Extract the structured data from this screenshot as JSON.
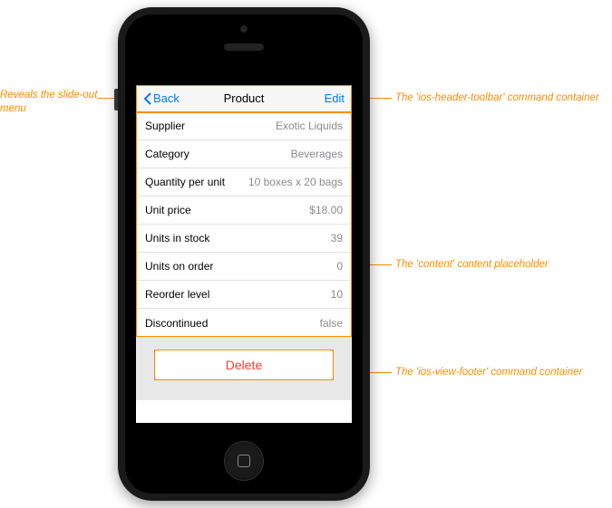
{
  "toolbar": {
    "back_label": "Back",
    "title": "Product",
    "edit_label": "Edit"
  },
  "details": [
    {
      "label": "Supplier",
      "value": "Exotic Liquids"
    },
    {
      "label": "Category",
      "value": "Beverages"
    },
    {
      "label": "Quantity per unit",
      "value": "10 boxes x 20 bags"
    },
    {
      "label": "Unit price",
      "value": "$18.00"
    },
    {
      "label": "Units in stock",
      "value": "39"
    },
    {
      "label": "Units on order",
      "value": "0"
    },
    {
      "label": "Reorder level",
      "value": "10"
    },
    {
      "label": "Discontinued",
      "value": "false"
    }
  ],
  "footer": {
    "delete_label": "Delete"
  },
  "annotations": {
    "left": "Reveals the slide-out menu",
    "right_toolbar": "The 'ios-header-toolbar' command container",
    "right_content": "The 'content' content placeholder",
    "right_footer": "The 'ios-view-footer' command container"
  }
}
